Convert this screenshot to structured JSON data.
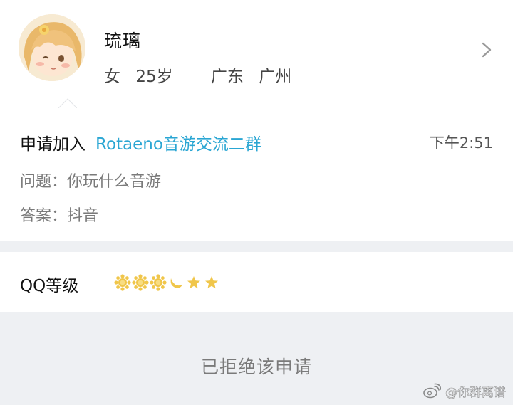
{
  "profile": {
    "nickname": "琉璃",
    "gender": "女",
    "age": "25岁",
    "province": "广东",
    "city": "广州"
  },
  "request": {
    "prefix": "申请加入",
    "group_name": "Rotaeno音游交流二群",
    "time": "下午2:51",
    "question": "问题：你玩什么音游",
    "answer": "答案：抖音"
  },
  "level": {
    "label": "QQ等级",
    "badges": [
      "sun-icon",
      "sun-icon",
      "sun-icon",
      "moon-icon",
      "star-icon",
      "star-icon"
    ]
  },
  "status": {
    "text": "已拒绝该申请"
  },
  "watermark": {
    "text": "@你群离谱"
  },
  "colors": {
    "group_link": "#2aa6d3",
    "background": "#eef0f3",
    "badge_gold": "#f0c64a"
  }
}
